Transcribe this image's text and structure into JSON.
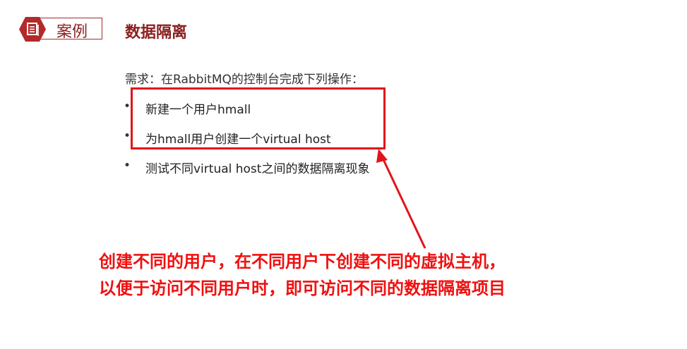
{
  "header": {
    "badge_label": "案例",
    "title": "数据隔离"
  },
  "requirement": "需求：在RabbitMQ的控制台完成下列操作：",
  "items": [
    "新建一个用户hmall",
    "为hmall用户创建一个virtual host",
    "测试不同virtual host之间的数据隔离现象"
  ],
  "bullet": "•",
  "annotation": {
    "line1": "创建不同的用户，在不同用户下创建不同的虚拟主机，",
    "line2": "以便于访问不同用户时，即可访问不同的数据隔离项目"
  },
  "colors": {
    "brand": "#a52a2a",
    "annotation": "#e0151b"
  }
}
